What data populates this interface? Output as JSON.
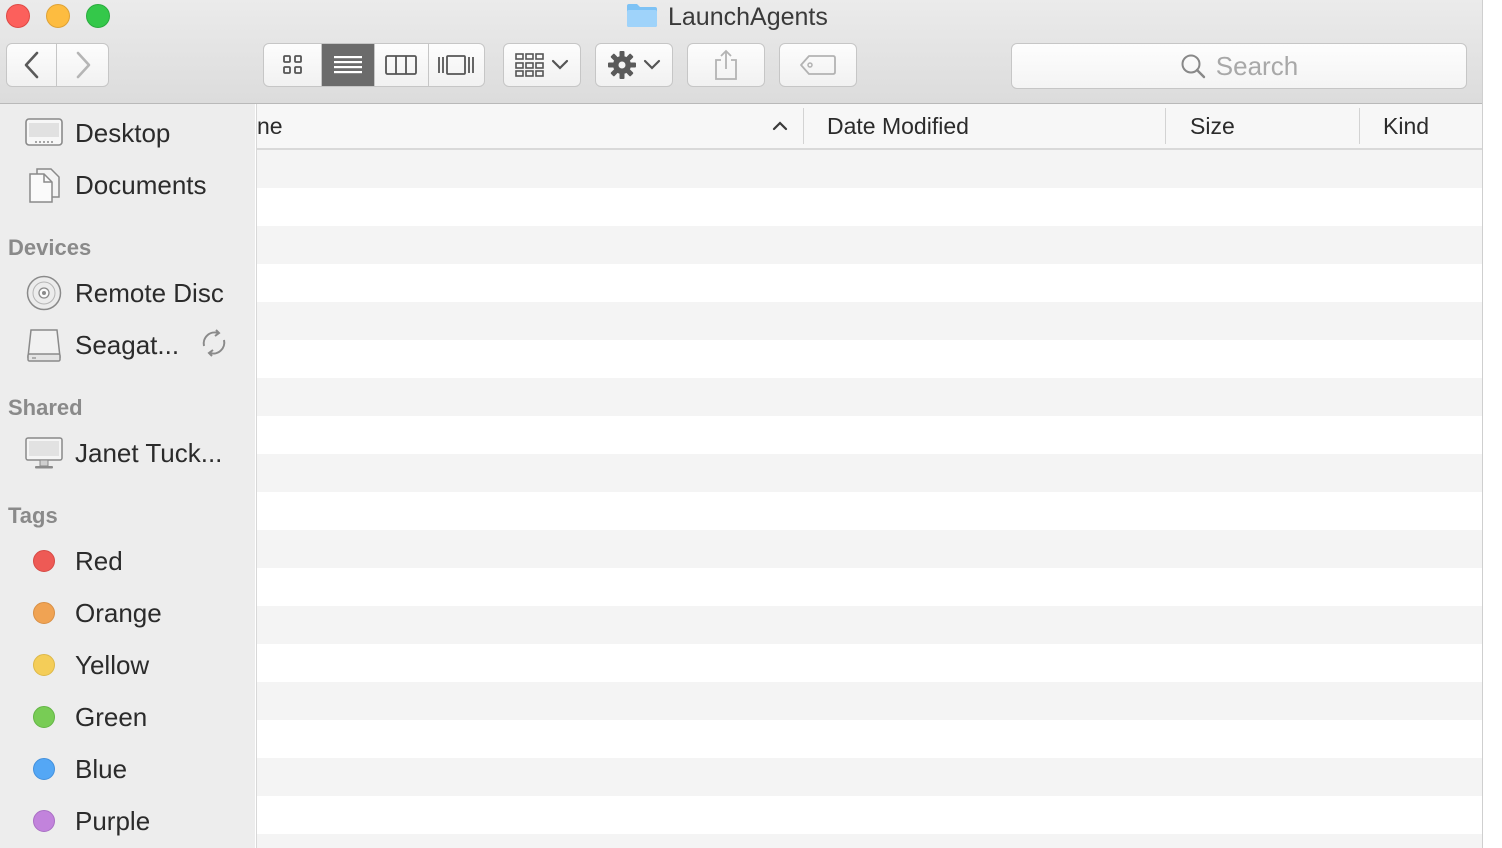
{
  "window": {
    "title": "LaunchAgents"
  },
  "toolbar": {
    "back_icon": "chevron-left-icon",
    "forward_icon": "chevron-right-icon",
    "view_modes": [
      "icon-view",
      "list-view",
      "column-view",
      "cover-flow-view"
    ],
    "active_view": "list-view",
    "group_icon": "arrange-icon",
    "action_icon": "gear-icon",
    "share_icon": "share-icon",
    "tag_icon": "tag-icon",
    "search_placeholder": "Search"
  },
  "sidebar": {
    "favorites": [
      {
        "label": "Desktop",
        "icon": "desktop-icon"
      },
      {
        "label": "Documents",
        "icon": "documents-icon"
      }
    ],
    "devices_heading": "Devices",
    "devices": [
      {
        "label": "Remote Disc",
        "icon": "disc-icon"
      },
      {
        "label": "Seagat...",
        "icon": "external-drive-icon"
      }
    ],
    "shared_heading": "Shared",
    "shared": [
      {
        "label": "Janet Tuck...",
        "icon": "computer-icon"
      }
    ],
    "tags_heading": "Tags",
    "tags": [
      {
        "label": "Red",
        "color": "#ee5a55"
      },
      {
        "label": "Orange",
        "color": "#f0a353"
      },
      {
        "label": "Yellow",
        "color": "#f4cd58"
      },
      {
        "label": "Green",
        "color": "#78cc55"
      },
      {
        "label": "Blue",
        "color": "#54a7f5"
      },
      {
        "label": "Purple",
        "color": "#c283dc"
      }
    ]
  },
  "list": {
    "columns": {
      "name": "ne",
      "date_modified": "Date Modified",
      "size": "Size",
      "kind": "Kind"
    },
    "sort_indicator": "sort-ascending-icon"
  }
}
